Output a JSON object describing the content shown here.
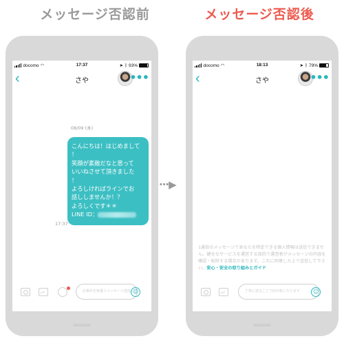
{
  "headings": {
    "before": "メッセージ否認前",
    "after": "メッセージ否認後"
  },
  "colors": {
    "accent": "#3cbfc3",
    "after_heading": "#ec5a4f",
    "before_heading": "#9a9a9a",
    "phone_frame": "#d9d9d9"
  },
  "arrow": "···▶",
  "before": {
    "status": {
      "carrier": "docomo",
      "time": "17:37",
      "battery": "93%",
      "battery_level": 0.93
    },
    "nav": {
      "back": "‹",
      "title": "さや",
      "more": "•••"
    },
    "date_label": "08/09 (木)",
    "message_lines": [
      "こんにちは！はじめまして",
      "！",
      "笑顔が素敵だなと思って",
      "いいねさせて頂きました",
      "！",
      "よろしければラインでお",
      "話ししませんか！？",
      "よろしくです＊＊"
    ],
    "line_id_label": "LINE ID：",
    "message_time": "17:37",
    "input_placeholder": "お相手を気遣うメッセージ送信しよう",
    "emoji": "☺"
  },
  "after": {
    "status": {
      "carrier": "docomo",
      "time": "18:13",
      "battery": "79%",
      "battery_level": 0.79
    },
    "nav": {
      "back": "‹",
      "title": "さや",
      "more": "•••"
    },
    "notice_text": "1通目のメッセージであなたを特定できる個人情報は送信できません。健全なサービスを運営する目的で運営者がメッセージの内容を確認・削除する場合があります。これに同意した上で送信して下さい。",
    "notice_link": "安心・安全の取り組みとガイド",
    "input_placeholder": "丁寧に送ることで好印象になります",
    "emoji": "☺"
  }
}
